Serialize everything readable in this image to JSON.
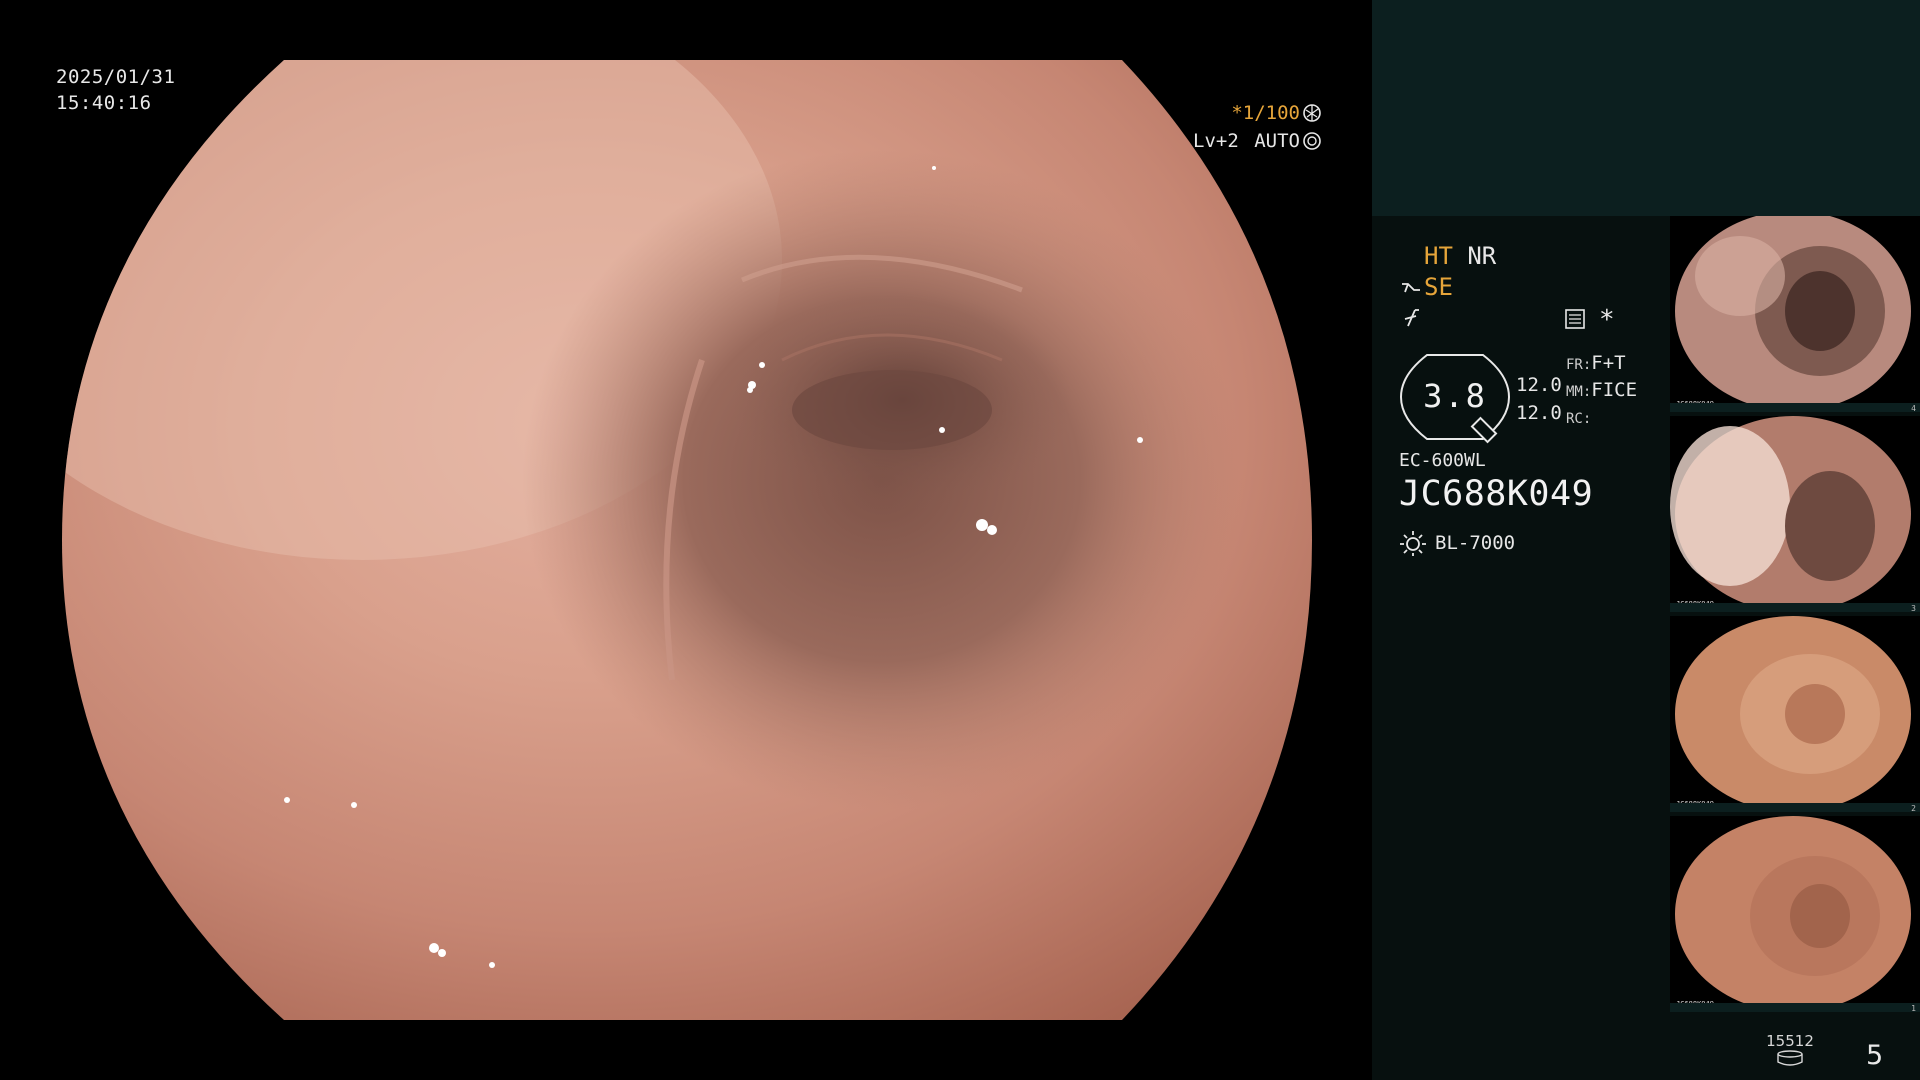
{
  "overlay": {
    "date": "2025/01/31",
    "time": "15:40:16",
    "shutter_speed": "*1/100",
    "level": "Lv+2",
    "exposure_mode": "AUTO"
  },
  "settings": {
    "ht": "HT",
    "nr": "NR",
    "se": "SE",
    "star": "*",
    "zoom_value": "3.8",
    "value_1": "12.0",
    "value_2": "12.0",
    "fr_key": "FR:",
    "fr_val": "F+T",
    "mm_key": "MM:",
    "mm_val": "FICE",
    "rc_key": "RC:"
  },
  "scope": {
    "model": "EC-600WL",
    "serial": "JC688K049",
    "light_source": "BL-7000"
  },
  "thumbnails": [
    {
      "label": "JC688K049",
      "number": "4"
    },
    {
      "label": "JC688K049",
      "number": "3"
    },
    {
      "label": "JC688K049",
      "number": "2"
    },
    {
      "label": "JC688K049",
      "number": "1"
    }
  ],
  "storage": {
    "count": "15512"
  },
  "page": {
    "number": "5"
  },
  "icons": [
    "aperture-icon",
    "iris-icon",
    "scope-tip-icon",
    "enhancement-icon",
    "memory-icon",
    "sun-icon",
    "database-icon"
  ],
  "colors": {
    "orange_accent": "#e6a53a",
    "panel_dark": "#07100f",
    "panel_teal": "#0c1f1f",
    "tissue": "#c08470"
  }
}
